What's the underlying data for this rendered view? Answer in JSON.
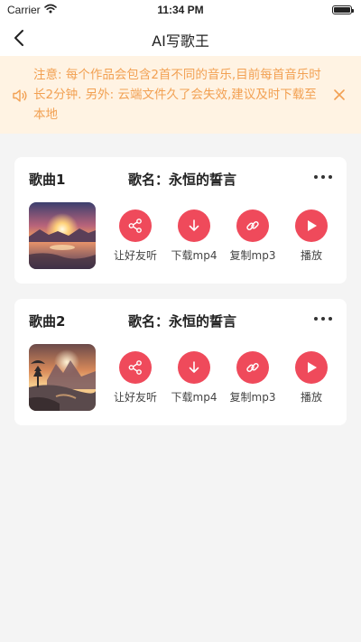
{
  "status_bar": {
    "carrier": "Carrier",
    "time": "11:34 PM"
  },
  "nav": {
    "title": "AI写歌王"
  },
  "notice": {
    "text": "注意: 每个作品会包含2首不同的音乐,目前每首音乐时长2分钟. 另外: 云端文件久了会失效,建议及时下载至本地"
  },
  "colors": {
    "accent": "#ef4a5b",
    "notice_bg": "#fff3e3",
    "notice_text": "#f2a052"
  },
  "songs": [
    {
      "label": "歌曲1",
      "name_prefix": "歌名：",
      "name": "永恒的誓言",
      "actions": {
        "share": "让好友听",
        "download_mp4": "下载mp4",
        "copy_mp3": "复制mp3",
        "play": "播放"
      }
    },
    {
      "label": "歌曲2",
      "name_prefix": "歌名：",
      "name": "永恒的誓言",
      "actions": {
        "share": "让好友听",
        "download_mp4": "下载mp4",
        "copy_mp3": "复制mp3",
        "play": "播放"
      }
    }
  ],
  "icons": [
    "wifi-icon",
    "battery-icon",
    "back-icon",
    "speaker-icon",
    "close-icon",
    "more-icon",
    "share-icon",
    "download-icon",
    "link-icon",
    "play-icon"
  ]
}
